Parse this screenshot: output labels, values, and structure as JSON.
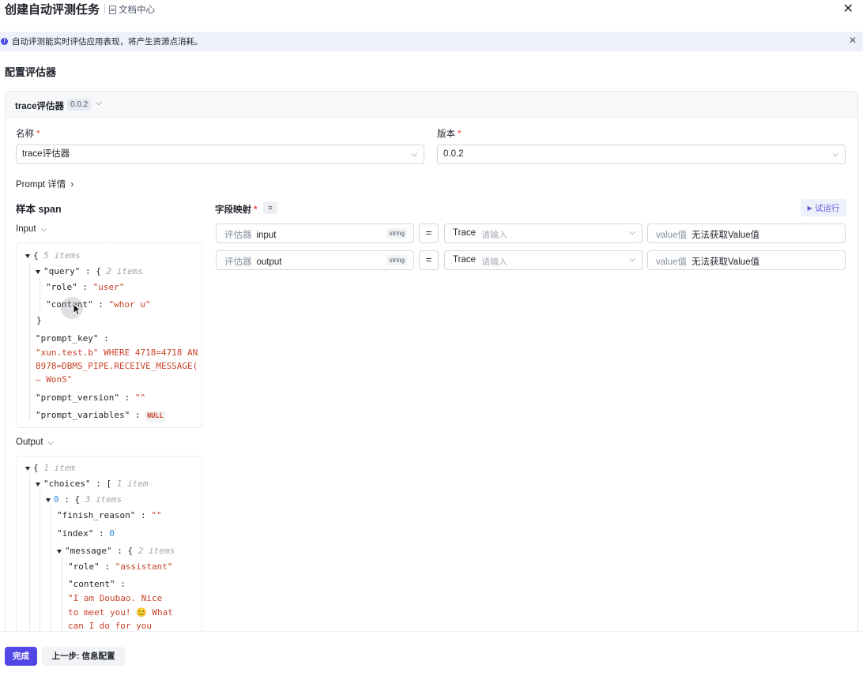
{
  "header": {
    "title": "创建自动评测任务",
    "doc_link": "文档中心",
    "close_icon": "close-icon"
  },
  "notice": {
    "text": "自动评测能实时评估应用表现，将产生资源点消耗。",
    "icon": "info-icon"
  },
  "section": {
    "title": "配置评估器"
  },
  "evaluator": {
    "name": "trace评估器",
    "version_badge": "0.0.2",
    "name_label": "名称",
    "name_value": "trace评估器",
    "version_label": "版本",
    "version_value": "0.0.2",
    "prompt_detail": "Prompt 详情"
  },
  "sample": {
    "title": "样本 span",
    "input_label": "Input",
    "output_label": "Output",
    "input_json": {
      "root_meta": "5 items",
      "query_key": "\"query\"",
      "query_meta": "2 items",
      "role_key": "\"role\"",
      "role_val": "\"user\"",
      "content_key": "\"content\"",
      "content_val": "\"whor u\"",
      "prompt_key_key": "\"prompt_key\"",
      "prompt_key_val_1": "\"xun.test.b\" WHERE 4718=4718 AN",
      "prompt_key_val_2": "8978=DBMS_PIPE.RECEIVE_MESSAGE(",
      "prompt_key_val_3": "— WonS\"",
      "prompt_version_key": "\"prompt_version\"",
      "prompt_version_val": "\"\"",
      "prompt_variables_key": "\"prompt_variables\"",
      "prompt_variables_val": "NULL"
    },
    "output_json": {
      "root_meta": "1 item",
      "choices_key": "\"choices\"",
      "choices_meta": "1 item",
      "idx0_key": "0",
      "idx0_meta": "3 items",
      "finish_reason_key": "\"finish_reason\"",
      "finish_reason_val": "\"\"",
      "index_key": "\"index\"",
      "index_val": "0",
      "message_key": "\"message\"",
      "message_meta": "2 items",
      "role_key": "\"role\"",
      "role_val": "\"assistant\"",
      "content_key": "\"content\"",
      "content_val_1": "\"I am Doubao. Nice",
      "content_val_2": "to meet you! 😊 What",
      "content_val_3": "can I do for you"
    }
  },
  "mapping": {
    "title": "字段映射",
    "try_run": "试运行",
    "rows": [
      {
        "prefix": "评估器",
        "field": "input",
        "type": "string",
        "eq": "=",
        "source": "Trace",
        "source_placeholder": "请输入",
        "value_prefix": "value值",
        "value_text": "无法获取Value值"
      },
      {
        "prefix": "评估器",
        "field": "output",
        "type": "string",
        "eq": "=",
        "source": "Trace",
        "source_placeholder": "请输入",
        "value_prefix": "value值",
        "value_text": "无法获取Value值"
      }
    ]
  },
  "footer": {
    "finish": "完成",
    "prev": "上一步: 信息配置"
  },
  "colors": {
    "primary": "#5147e5",
    "string_value": "#c9422a",
    "number_value": "#2d8ce0",
    "required": "#f53f3f"
  }
}
